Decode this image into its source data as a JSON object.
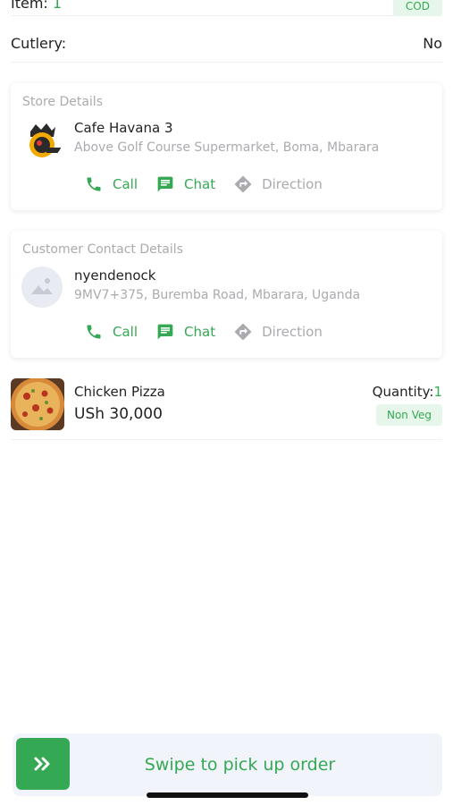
{
  "order": {
    "item_label": "Item:",
    "item_count": "1",
    "payment_badge": "COD",
    "cutlery_label": "Cutlery:",
    "cutlery_value": "No"
  },
  "store": {
    "section_title": "Store Details",
    "name": "Cafe Havana 3",
    "address": "Above Golf Course Supermarket, Boma, Mbarara",
    "actions": {
      "call": "Call",
      "chat": "Chat",
      "direction": "Direction"
    }
  },
  "customer": {
    "section_title": "Customer Contact Details",
    "name": "nyendenock",
    "address": "9MV7+375, Buremba Road, Mbarara, Uganda",
    "actions": {
      "call": "Call",
      "chat": "Chat",
      "direction": "Direction"
    }
  },
  "product": {
    "name": "Chicken Pizza",
    "price": "USh 30,000",
    "quantity_label": "Quantity:",
    "quantity_value": "1",
    "veg_badge": "Non Veg"
  },
  "swipe": {
    "label": "Swipe to pick up order"
  },
  "colors": {
    "accent": "#34a853",
    "muted": "#a9abae"
  }
}
